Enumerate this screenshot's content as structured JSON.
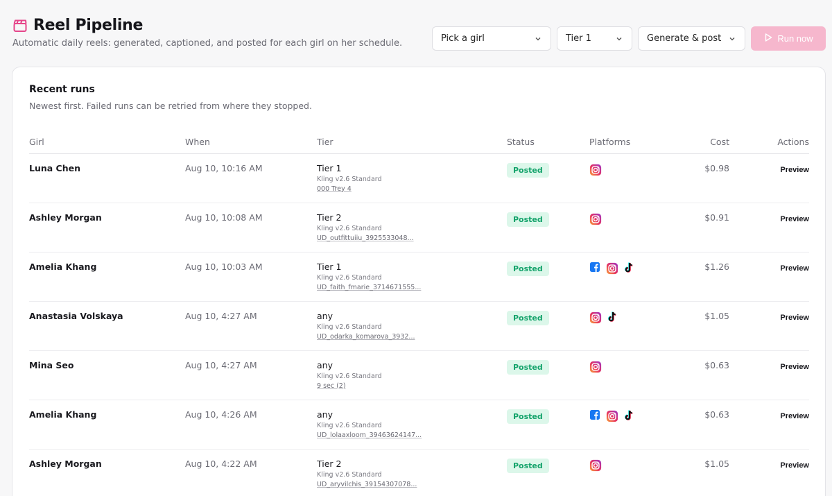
{
  "header": {
    "title": "Reel Pipeline",
    "subtitle": "Automatic daily reels: generated, captioned, and posted for each girl on her schedule."
  },
  "controls": {
    "girl_select": "Pick a girl",
    "tier_select": "Tier 1",
    "mode_select": "Generate & post",
    "run_label": "Run now"
  },
  "recent": {
    "title": "Recent runs",
    "subtitle": "Newest first. Failed runs can be retried from where they stopped.",
    "columns": [
      "Girl",
      "When",
      "Tier",
      "Status",
      "Platforms",
      "Cost",
      "Actions"
    ],
    "rows": [
      {
        "girl": "Luna Chen",
        "when": "Aug 10, 10:16 AM",
        "tier": "Tier 1",
        "model": "Kling v2.6 Standard",
        "file": "000 Trey 4",
        "status": "Posted",
        "platforms": [
          "instagram"
        ],
        "cost": "$0.98",
        "action": "Preview"
      },
      {
        "girl": "Ashley Morgan",
        "when": "Aug 10, 10:08 AM",
        "tier": "Tier 2",
        "model": "Kling v2.6 Standard",
        "file": "UD_outfittuiiu_3925533048...",
        "status": "Posted",
        "platforms": [
          "instagram"
        ],
        "cost": "$0.91",
        "action": "Preview"
      },
      {
        "girl": "Amelia Khang",
        "when": "Aug 10, 10:03 AM",
        "tier": "Tier 1",
        "model": "Kling v2.6 Standard",
        "file": "UD_faith_fmarie_3714671555...",
        "status": "Posted",
        "platforms": [
          "facebook",
          "instagram",
          "tiktok"
        ],
        "cost": "$1.26",
        "action": "Preview"
      },
      {
        "girl": "Anastasia Volskaya",
        "when": "Aug 10, 4:27 AM",
        "tier": "any",
        "model": "Kling v2.6 Standard",
        "file": "UD_odarka_komarova_3932...",
        "status": "Posted",
        "platforms": [
          "instagram",
          "tiktok"
        ],
        "cost": "$1.05",
        "action": "Preview"
      },
      {
        "girl": "Mina Seo",
        "when": "Aug 10, 4:27 AM",
        "tier": "any",
        "model": "Kling v2.6 Standard",
        "file": "9 sec (2)",
        "status": "Posted",
        "platforms": [
          "instagram"
        ],
        "cost": "$0.63",
        "action": "Preview"
      },
      {
        "girl": "Amelia Khang",
        "when": "Aug 10, 4:26 AM",
        "tier": "any",
        "model": "Kling v2.6 Standard",
        "file": "UD_lolaaxloom_39463624147...",
        "status": "Posted",
        "platforms": [
          "facebook",
          "instagram",
          "tiktok"
        ],
        "cost": "$0.63",
        "action": "Preview"
      },
      {
        "girl": "Ashley Morgan",
        "when": "Aug 10, 4:22 AM",
        "tier": "Tier 2",
        "model": "Kling v2.6 Standard",
        "file": "UD_aryvilchis_39154307078...",
        "status": "Posted",
        "platforms": [
          "instagram"
        ],
        "cost": "$1.05",
        "action": "Preview"
      }
    ]
  },
  "colors": {
    "brand": "#e6458a",
    "run_button": "#f6b7cd",
    "posted_bg": "#dcf7ea",
    "posted_text": "#14a36b"
  },
  "icons": {
    "title": "clapperboard-icon",
    "select": "chevron-down-icon",
    "run": "play-icon",
    "platforms": [
      "facebook-icon",
      "instagram-icon",
      "tiktok-icon"
    ]
  }
}
